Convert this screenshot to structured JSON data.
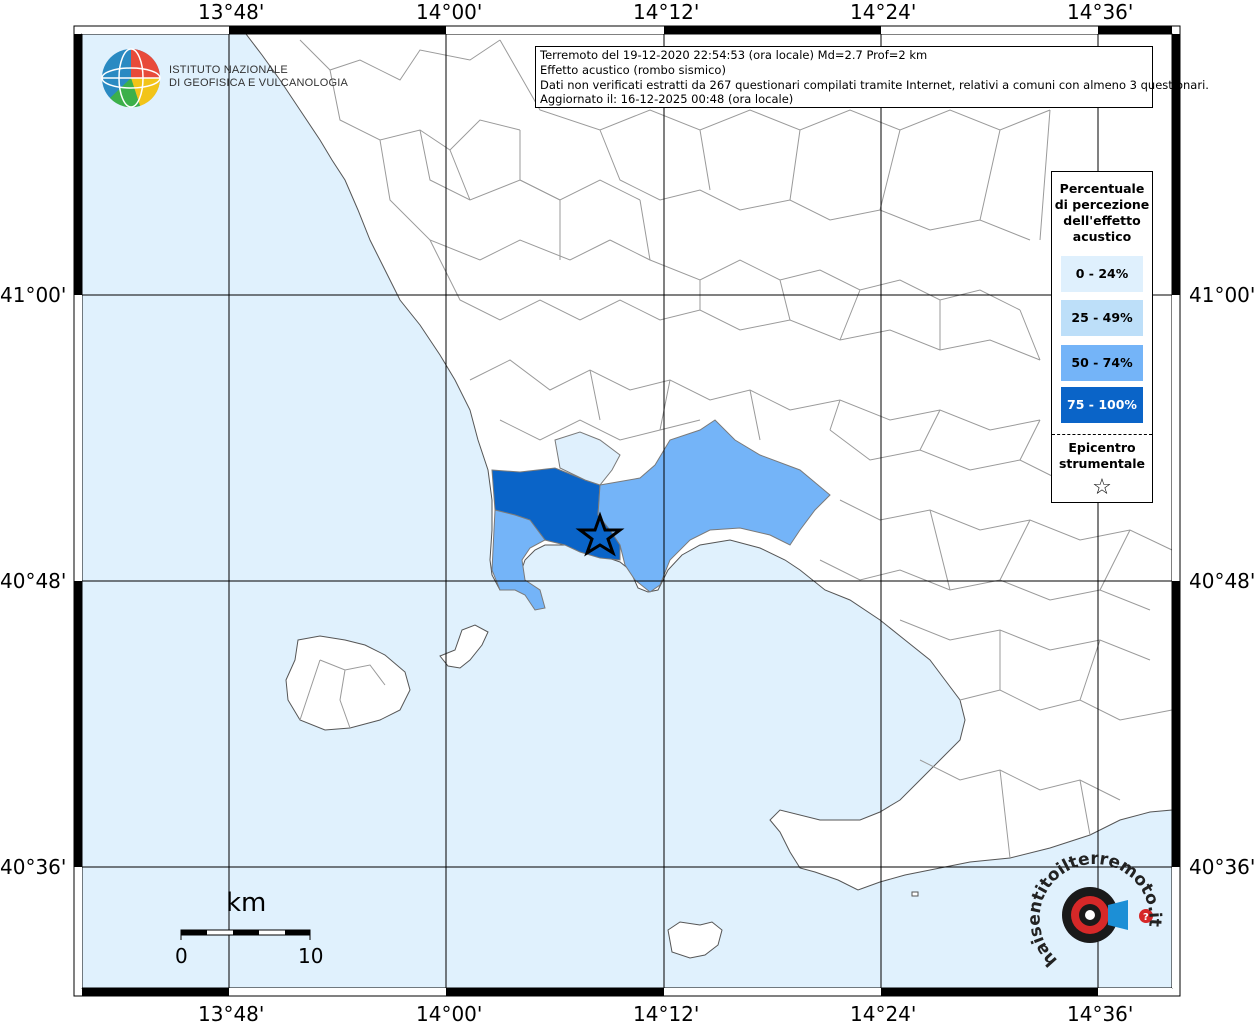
{
  "header": {
    "line1": "Terremoto del 19-12-2020 22:54:53 (ora locale) Md=2.7 Prof=2 km",
    "line2": "Effetto acustico (rombo sismico)",
    "line3": "Dati non verificati estratti da 267 questionari compilati tramite Internet, relativi a comuni con almeno 3 questionari.",
    "line4": "Aggiornato il: 16-12-2025 00:48 (ora locale)"
  },
  "logo": {
    "line1": "ISTITUTO NAZIONALE",
    "line2": "DI GEOFISICA E VULCANOLOGIA"
  },
  "axes": {
    "top": [
      "13°48'",
      "14°00'",
      "14°12'",
      "14°24'",
      "14°36'"
    ],
    "bottom": [
      "13°48'",
      "14°00'",
      "14°12'",
      "14°24'",
      "14°36'"
    ],
    "left": [
      "41°00'",
      "40°48'",
      "40°36'"
    ],
    "right": [
      "41°00'",
      "40°48'",
      "40°36'"
    ]
  },
  "legend": {
    "title1": "Percentuale",
    "title2": "di percezione",
    "title3": "dell'effetto",
    "title4": "acustico",
    "items": [
      {
        "label": "0 - 24%",
        "color": "#dff0fd",
        "text_color": "#000000"
      },
      {
        "label": "25 - 49%",
        "color": "#bddff9",
        "text_color": "#000000"
      },
      {
        "label": "50 - 74%",
        "color": "#74b4f8",
        "text_color": "#000000"
      },
      {
        "label": "75 - 100%",
        "color": "#0a64c8",
        "text_color": "#ffffff"
      }
    ],
    "epicenter1": "Epicentro",
    "epicenter2": "strumentale",
    "star": "☆"
  },
  "scale": {
    "unit": "km",
    "start": "0",
    "end": "10"
  },
  "colors": {
    "sea": "#e0f1fd",
    "land": "#ffffff",
    "borders": "#9a9a9a",
    "grid": "#000000"
  },
  "watermark": {
    "text": "haisentitoilterremoto.it"
  }
}
